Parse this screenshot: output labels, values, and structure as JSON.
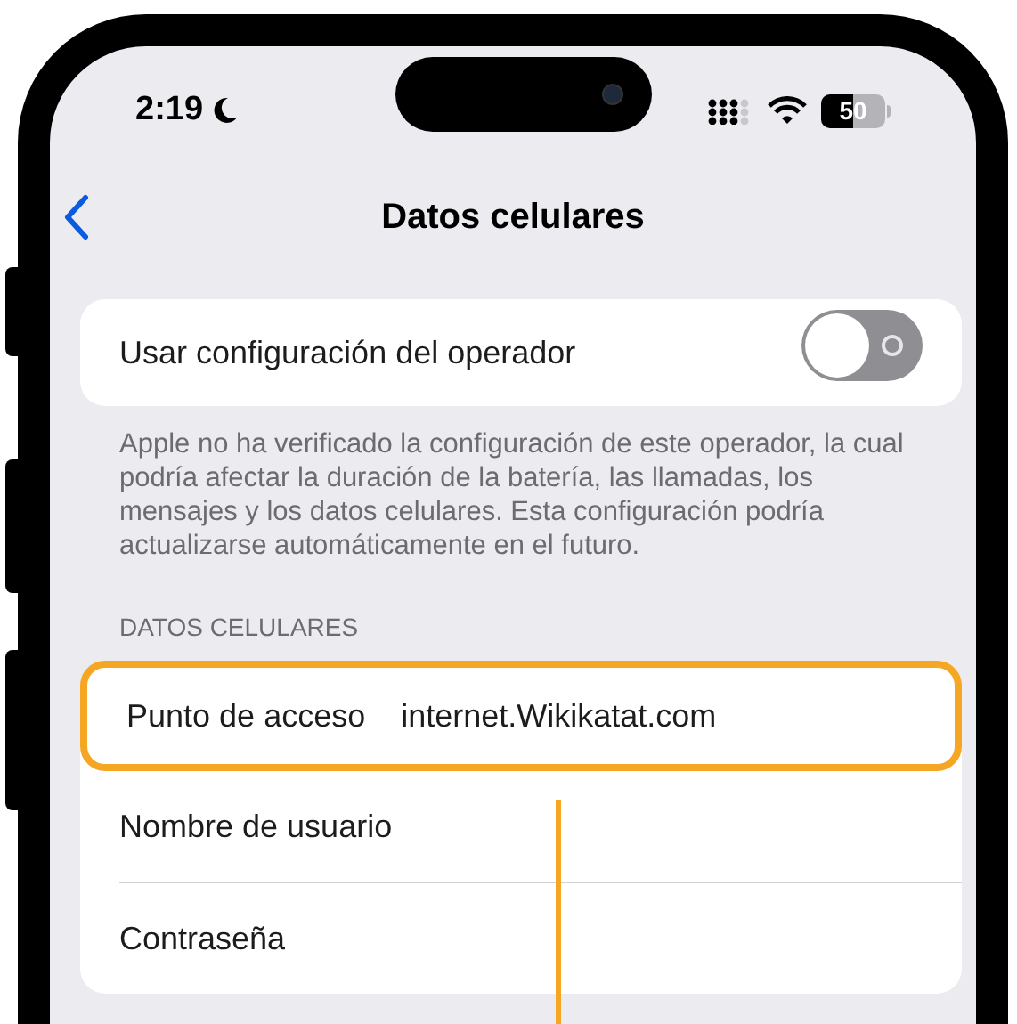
{
  "status_bar": {
    "time": "2:19",
    "battery": "50"
  },
  "nav": {
    "title": "Datos celulares"
  },
  "carrier_toggle": {
    "label": "Usar configuración del operador",
    "on": false
  },
  "footer_note": "Apple no ha verificado la configuración de este operador, la cual podría afectar la duración de la batería, las llamadas, los mensajes y los datos celulares. Esta configuración podría actualizarse automáticamente en el futuro.",
  "section_header": "DATOS CELULARES",
  "fields": [
    {
      "label": "Punto de acceso",
      "value": "internet.Wikikatat.com",
      "highlighted": true
    },
    {
      "label": "Nombre de usuario",
      "highlighted": false
    },
    {
      "label": "Contraseña",
      "highlighted": false
    }
  ]
}
